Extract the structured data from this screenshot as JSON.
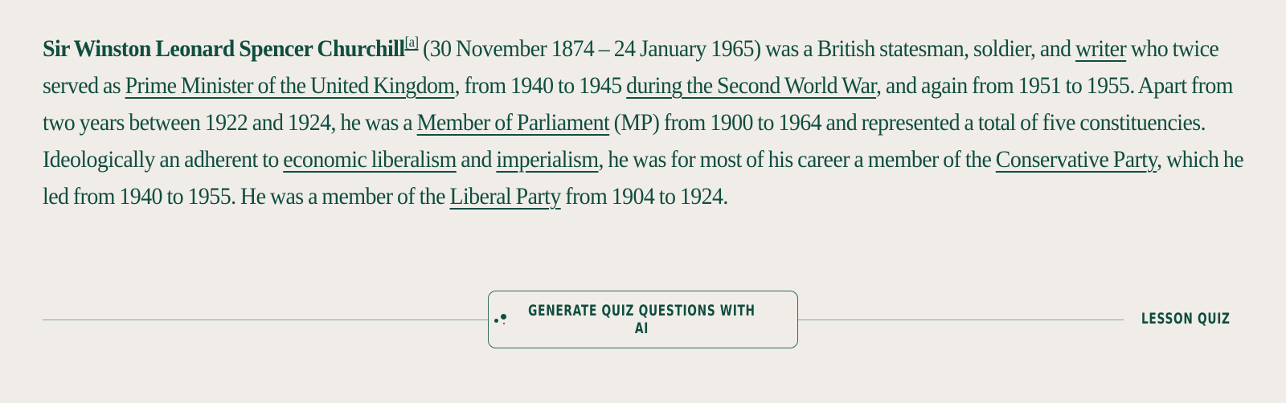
{
  "article": {
    "segments": [
      {
        "type": "bold",
        "text": "Sir Winston Leonard Spencer Churchill"
      },
      {
        "type": "footnote",
        "text": "[a]"
      },
      {
        "type": "text",
        "text": " (30 November 1874 – 24 January 1965) was a British statesman, soldier, and "
      },
      {
        "type": "link",
        "text": "writer"
      },
      {
        "type": "text",
        "text": " who twice served as "
      },
      {
        "type": "link",
        "text": "Prime Minister of the United Kingdom"
      },
      {
        "type": "text",
        "text": ", from 1940 to 1945 "
      },
      {
        "type": "link",
        "text": "during the Second World War"
      },
      {
        "type": "text",
        "text": ", and again from 1951 to 1955. Apart from two years between 1922 and 1924, he was a "
      },
      {
        "type": "link",
        "text": "Member of Parliament"
      },
      {
        "type": "text",
        "text": " (MP) from 1900 to 1964 and represented a total of five constituencies. Ideologically an adherent to "
      },
      {
        "type": "link",
        "text": "economic liberalism"
      },
      {
        "type": "text",
        "text": " and "
      },
      {
        "type": "link",
        "text": "imperialism"
      },
      {
        "type": "text",
        "text": ", he was for most of his career a member of the "
      },
      {
        "type": "link",
        "text": "Conservative Party"
      },
      {
        "type": "text",
        "text": ", which he led from 1940 to 1955. He was a member of the "
      },
      {
        "type": "link",
        "text": "Liberal Party"
      },
      {
        "type": "text",
        "text": " from 1904 to 1924."
      }
    ]
  },
  "actions": {
    "generate_label": "GENERATE QUIZ QUESTIONS WITH AI",
    "generate_icon": "ai-sparkle-dots-icon",
    "section_label": "LESSON QUIZ"
  },
  "colors": {
    "background": "#f0ede8",
    "text": "#0f4d3f",
    "divider": "#8aa59c"
  }
}
